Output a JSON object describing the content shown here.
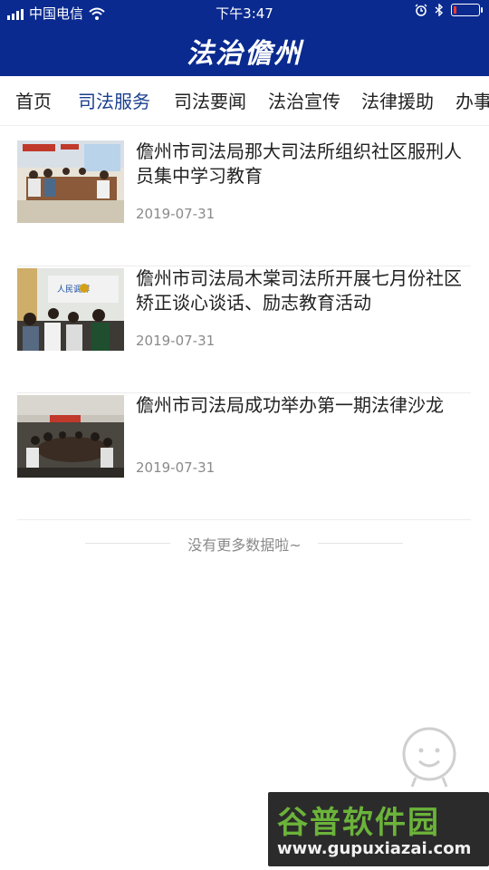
{
  "status_bar": {
    "carrier": "中国电信",
    "time": "下午3:47",
    "battery_level": 0.12
  },
  "header": {
    "brand": "法治儋州"
  },
  "tabs": [
    {
      "label": "首页",
      "active": false
    },
    {
      "label": "司法服务",
      "active": true
    },
    {
      "label": "司法要闻",
      "active": false
    },
    {
      "label": "法治宣传",
      "active": false
    },
    {
      "label": "法律援助",
      "active": false
    },
    {
      "label": "办事",
      "active": false
    }
  ],
  "articles": [
    {
      "title": "儋州市司法局那大司法所组织社区服刑人员集中学习教育",
      "date": "2019-07-31"
    },
    {
      "title": "儋州市司法局木棠司法所开展七月份社区矫正谈心谈话、励志教育活动",
      "date": "2019-07-31"
    },
    {
      "title": "儋州市司法局成功举办第一期法律沙龙",
      "date": "2019-07-31"
    }
  ],
  "thumb_texts": {
    "banner2": "人民调解"
  },
  "list_end": "没有更多数据啦~",
  "watermark": {
    "big": "谷普软件园",
    "small": "www.gupuxiazai.com"
  },
  "colors": {
    "header": "#0a2a8f",
    "active_tab": "#1a3f8f",
    "muted": "#8a8a8a"
  }
}
